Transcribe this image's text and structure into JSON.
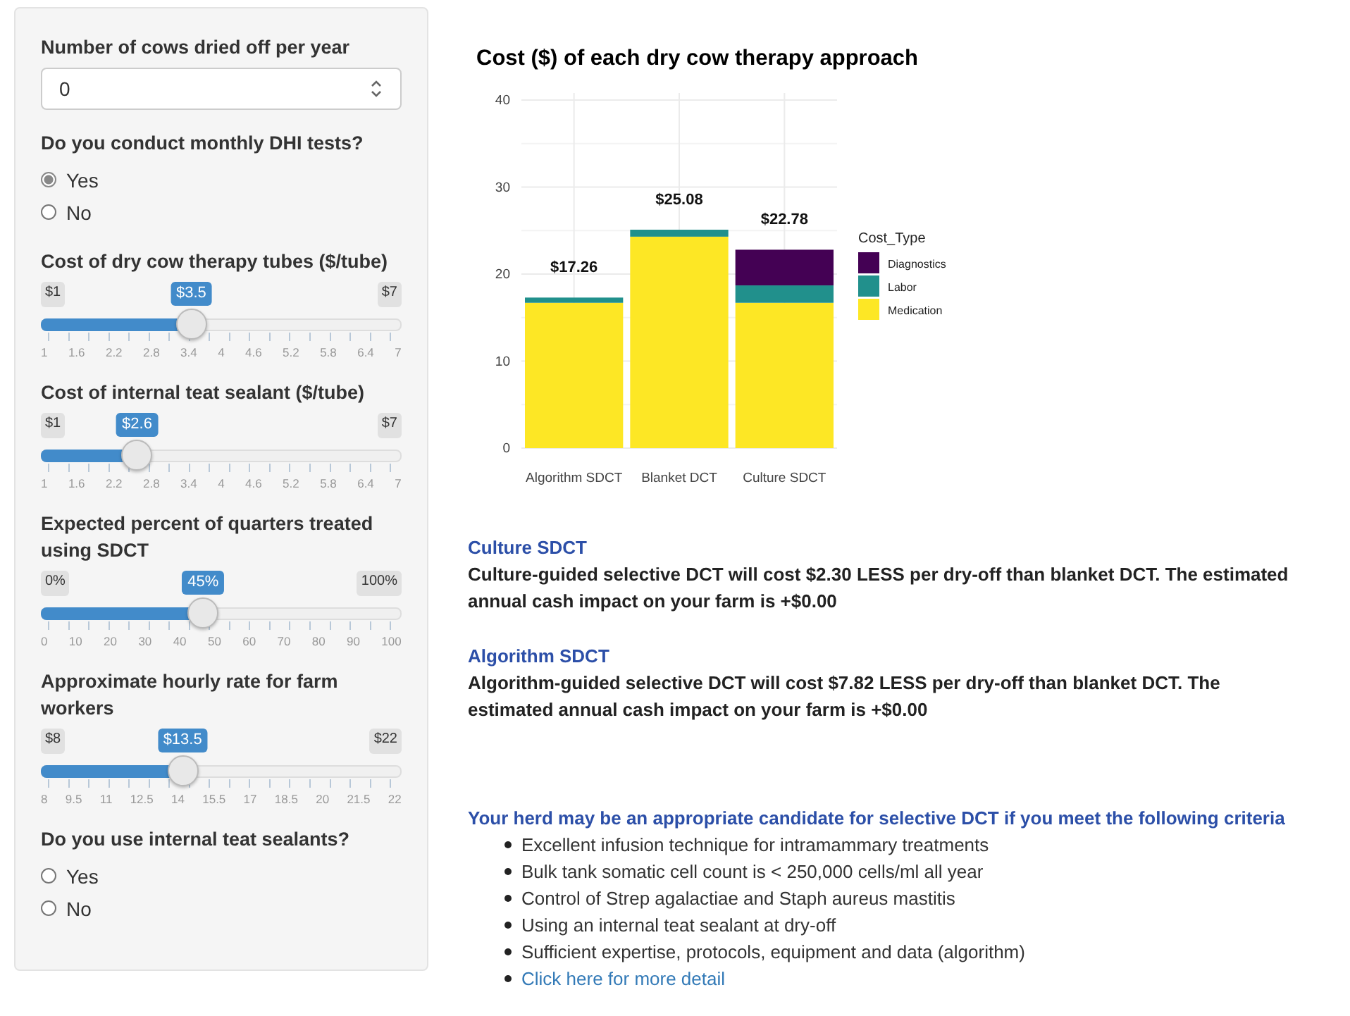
{
  "inputs": [
    {
      "kind": "number",
      "label": "Number of cows dried off per year",
      "value": "0"
    },
    {
      "kind": "radio",
      "label": "Do you conduct monthly DHI tests?",
      "options": [
        {
          "label": "Yes",
          "selected": true
        },
        {
          "label": "No",
          "selected": false
        }
      ]
    },
    {
      "kind": "slider",
      "label": "Cost of dry cow therapy tubes ($/tube)",
      "min_label": "$1",
      "max_label": "$7",
      "value_label": "$3.5",
      "level": 0.4167,
      "ticks": [
        "1",
        "1.6",
        "2.2",
        "2.8",
        "3.4",
        "4",
        "4.6",
        "5.2",
        "5.8",
        "6.4",
        "7"
      ]
    },
    {
      "kind": "slider",
      "label": "Cost of internal teat sealant ($/tube)",
      "min_label": "$1",
      "max_label": "$7",
      "value_label": "$2.6",
      "level": 0.2667,
      "ticks": [
        "1",
        "1.6",
        "2.2",
        "2.8",
        "3.4",
        "4",
        "4.6",
        "5.2",
        "5.8",
        "6.4",
        "7"
      ]
    },
    {
      "kind": "slider",
      "label": "Expected percent of quarters treated using SDCT",
      "min_label": "0%",
      "max_label": "100%",
      "value_label": "45%",
      "level": 0.45,
      "ticks": [
        "0",
        "10",
        "20",
        "30",
        "40",
        "50",
        "60",
        "70",
        "80",
        "90",
        "100"
      ]
    },
    {
      "kind": "slider",
      "label": "Approximate hourly rate for farm workers",
      "min_label": "$8",
      "max_label": "$22",
      "value_label": "$13.5",
      "level": 0.3929,
      "ticks": [
        "8",
        "9.5",
        "11",
        "12.5",
        "14",
        "15.5",
        "17",
        "18.5",
        "20",
        "21.5",
        "22"
      ]
    },
    {
      "kind": "radio",
      "label": "Do you use internal teat sealants?",
      "options": [
        {
          "label": "Yes",
          "selected": false
        },
        {
          "label": "No",
          "selected": false
        }
      ]
    }
  ],
  "chart_data": {
    "type": "bar",
    "title": "Cost ($) of each dry cow therapy approach",
    "categories": [
      "Algorithm SDCT",
      "Blanket DCT",
      "Culture SDCT"
    ],
    "stacked": true,
    "grid": true,
    "legend": {
      "title": "Cost_Type"
    },
    "series": [
      {
        "name": "Medication",
        "color": "#fde725",
        "values": [
          16.7,
          24.3,
          16.7
        ]
      },
      {
        "name": "Labor",
        "color": "#21908c",
        "values": [
          0.6,
          0.8,
          2.0
        ]
      },
      {
        "name": "Diagnostics",
        "color": "#440154",
        "values": [
          0,
          0,
          4.1
        ]
      }
    ],
    "ylim": [
      0,
      40
    ],
    "yticks": [
      0,
      10,
      20,
      30,
      40
    ],
    "value_labels": [
      "$17.26",
      "$25.08",
      "$22.78"
    ]
  },
  "results": [
    {
      "heading": "Culture SDCT",
      "text": "Culture-guided selective DCT will cost $2.30 LESS per dry-off than blanket DCT. The estimated annual cash impact on your farm is +$0.00"
    },
    {
      "heading": "Algorithm SDCT",
      "text": "Algorithm-guided selective DCT will cost $7.82 LESS per dry-off than blanket DCT. The estimated annual cash impact on your farm is +$0.00"
    }
  ],
  "criteria": {
    "heading": "Your herd may be an appropriate candidate for selective DCT if you meet the following criteria",
    "items": [
      "Excellent infusion technique for intramammary treatments",
      "Bulk tank somatic cell count is < 250,000 cells/ml all year",
      "Control of Strep agalactiae and Staph aureus mastitis",
      "Using an internal teat sealant at dry-off",
      "Sufficient expertise, protocols, equipment and data (algorithm)"
    ],
    "link": "Click here for more detail"
  }
}
